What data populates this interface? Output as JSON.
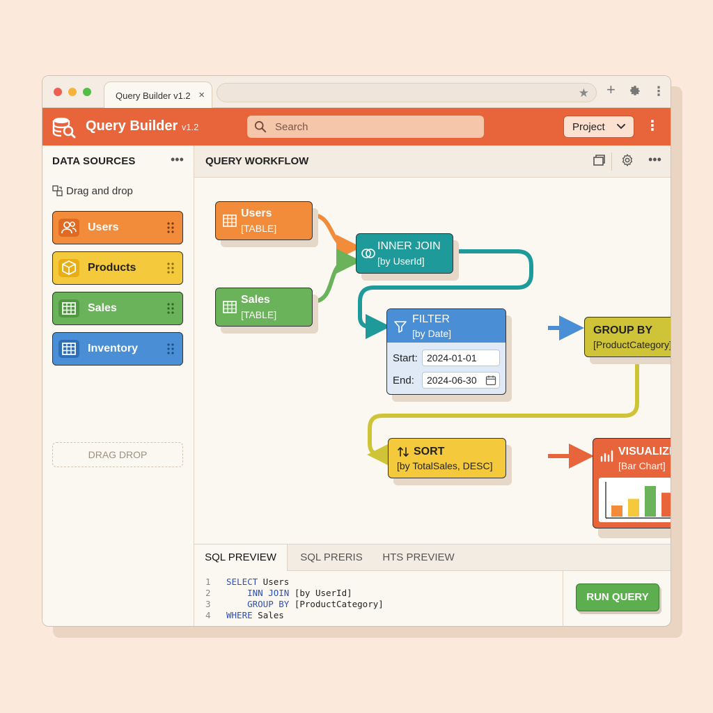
{
  "browser": {
    "tab_title": "Query Builder v1.2",
    "tab_close": "×",
    "star": "★",
    "new_tab": "+",
    "kebab": "⋮"
  },
  "app": {
    "title": "Query Builder",
    "version": "v1.2",
    "search_placeholder": "Search",
    "project_label": "Project",
    "kebab": "⋮"
  },
  "sidebar": {
    "title": "DATA SOURCES",
    "more": "•••",
    "hint": "Drag and drop",
    "items": [
      {
        "label": "Users",
        "icon": "users-icon",
        "color": "#f28c3a"
      },
      {
        "label": "Products",
        "icon": "box-icon",
        "color": "#f5c93c"
      },
      {
        "label": "Sales",
        "icon": "table-icon",
        "color": "#6ab35a"
      },
      {
        "label": "Inventory",
        "icon": "table-icon",
        "color": "#4a8fd6"
      }
    ],
    "drop_zone": "DRAG DROP"
  },
  "workflow": {
    "title": "QUERY WORKFLOW",
    "more": "•••",
    "nodes": {
      "users": {
        "title": "Users",
        "sub": "[TABLE]"
      },
      "sales": {
        "title": "Sales",
        "sub": "[TABLE]"
      },
      "join": {
        "title": "INNER JOIN",
        "sub": "[by UserId]"
      },
      "filter": {
        "title": "FILTER",
        "sub": "[by Date]",
        "start_label": "Start:",
        "start_value": "2024-01-01",
        "end_label": "End:",
        "end_value": "2024-06-30"
      },
      "group": {
        "title": "GROUP BY",
        "sub": "[ProductCategory]"
      },
      "sort": {
        "title": "SORT",
        "sub": "[by TotalSales, DESC]"
      },
      "visualize": {
        "title": "VISUALIZE",
        "sub": "[Bar Chart]"
      }
    },
    "mini_chart": {
      "type": "bar",
      "values": [
        2,
        3.2,
        5.5,
        4.3
      ],
      "colors": [
        "#f28c3a",
        "#f5c93c",
        "#6ab35a",
        "#e8643a"
      ]
    }
  },
  "bottom": {
    "tabs": [
      "SQL PREVIEW",
      "SQL PRERIS",
      "HTS PREVIEW"
    ],
    "active_tab": 0,
    "code_lines": [
      {
        "n": "1",
        "kw": "SELECT",
        "rest": " Users",
        "indent": ""
      },
      {
        "n": "2",
        "kw": "INN JOIN",
        "rest": " [by UserId]",
        "indent": "    "
      },
      {
        "n": "3",
        "kw": "GROUP BY",
        "rest": " [ProductCategory]",
        "indent": "    "
      },
      {
        "n": "4",
        "kw": "WHERE",
        "rest": " Sales",
        "indent": ""
      }
    ],
    "run_label": "RUN QUERY"
  }
}
